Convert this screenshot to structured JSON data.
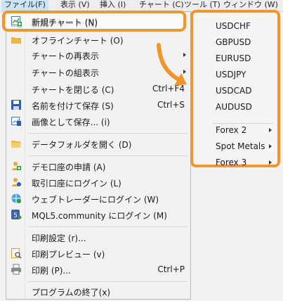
{
  "menubar": {
    "items": [
      {
        "label": "ファイル(F)"
      },
      {
        "label": "表示 (V)"
      },
      {
        "label": "挿入 (I)"
      },
      {
        "label": "チャート (C)"
      },
      {
        "label": "ツール (T)"
      },
      {
        "label": "ウィンドウ (W)"
      }
    ]
  },
  "file_menu": {
    "items": [
      {
        "label": "新規チャート (N)",
        "icon": "new-chart-icon"
      },
      {
        "label": "オフラインチャート (O)",
        "icon": "offline-chart-icon"
      },
      {
        "label": "チャートの再表示"
      },
      {
        "label": "チャートの組表示"
      },
      {
        "label": "チャートを閉じる (C)",
        "shortcut": "Ctrl+F4"
      },
      {
        "label": "名前を付けて保存 (S)",
        "shortcut": "Ctrl+S",
        "icon": "save-icon"
      },
      {
        "label": "画像として保存... (i)",
        "icon": "save-image-icon"
      },
      {
        "label": "データフォルダを開く (D)",
        "icon": "folder-icon"
      },
      {
        "label": "デモ口座の申請 (A)",
        "icon": "demo-account-icon"
      },
      {
        "label": "取引口座にログイン (L)",
        "icon": "login-icon"
      },
      {
        "label": "ウェブトレーダーにログイン (W)",
        "icon": "webtrader-icon"
      },
      {
        "label": "MQL5.community にログイン (M)",
        "icon": "mql5-icon"
      },
      {
        "label": "印刷設定 (r)..."
      },
      {
        "label": "印刷プレビュー (v)",
        "icon": "print-preview-icon"
      },
      {
        "label": "印刷 (P)...",
        "shortcut": "Ctrl+P",
        "icon": "print-icon"
      },
      {
        "label": "プログラムの終了(x)"
      }
    ]
  },
  "submenu": {
    "symbols": [
      "USDCHF",
      "GBPUSD",
      "EURUSD",
      "USDJPY",
      "USDCAD",
      "AUDUSD"
    ],
    "groups": [
      "Forex 2",
      "Spot Metals",
      "Forex 3"
    ]
  },
  "colors": {
    "highlight": "#f0962e"
  }
}
